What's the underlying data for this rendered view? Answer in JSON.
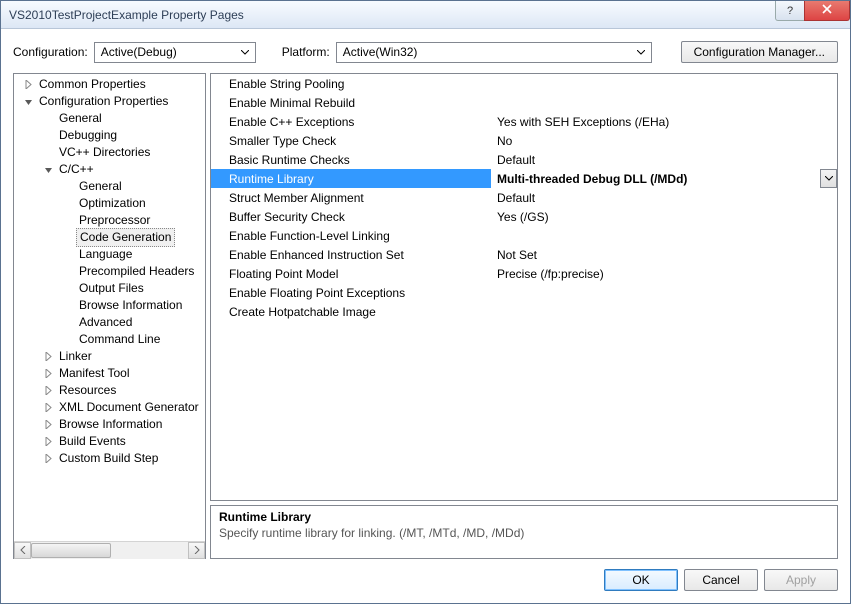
{
  "window": {
    "title": "VS2010TestProjectExample Property Pages"
  },
  "top": {
    "config_label": "Configuration:",
    "config_value": "Active(Debug)",
    "platform_label": "Platform:",
    "platform_value": "Active(Win32)",
    "manager_label": "Configuration Manager..."
  },
  "tree": {
    "rootA": "Common Properties",
    "rootB": "Configuration Properties",
    "b": {
      "general": "General",
      "debugging": "Debugging",
      "vcdirs": "VC++ Directories",
      "ccpp": "C/C++",
      "cc": {
        "general": "General",
        "optimization": "Optimization",
        "preprocessor": "Preprocessor",
        "codegen": "Code Generation",
        "language": "Language",
        "pch": "Precompiled Headers",
        "output": "Output Files",
        "browse": "Browse Information",
        "advanced": "Advanced",
        "cmdline": "Command Line"
      },
      "linker": "Linker",
      "manifest": "Manifest Tool",
      "resources": "Resources",
      "xmldoc": "XML Document Generator",
      "browse": "Browse Information",
      "buildevents": "Build Events",
      "custom": "Custom Build Step"
    }
  },
  "props": [
    {
      "name": "Enable String Pooling",
      "value": ""
    },
    {
      "name": "Enable Minimal Rebuild",
      "value": ""
    },
    {
      "name": "Enable C++ Exceptions",
      "value": "Yes with SEH Exceptions (/EHa)"
    },
    {
      "name": "Smaller Type Check",
      "value": "No"
    },
    {
      "name": "Basic Runtime Checks",
      "value": "Default"
    },
    {
      "name": "Runtime Library",
      "value": "Multi-threaded Debug DLL (/MDd)"
    },
    {
      "name": "Struct Member Alignment",
      "value": "Default"
    },
    {
      "name": "Buffer Security Check",
      "value": "Yes (/GS)"
    },
    {
      "name": "Enable Function-Level Linking",
      "value": ""
    },
    {
      "name": "Enable Enhanced Instruction Set",
      "value": "Not Set"
    },
    {
      "name": "Floating Point Model",
      "value": "Precise (/fp:precise)"
    },
    {
      "name": "Enable Floating Point Exceptions",
      "value": ""
    },
    {
      "name": "Create Hotpatchable Image",
      "value": ""
    }
  ],
  "selected_index": 5,
  "desc": {
    "title": "Runtime Library",
    "body": "Specify runtime library for linking.     (/MT, /MTd, /MD, /MDd)"
  },
  "footer": {
    "ok": "OK",
    "cancel": "Cancel",
    "apply": "Apply"
  }
}
